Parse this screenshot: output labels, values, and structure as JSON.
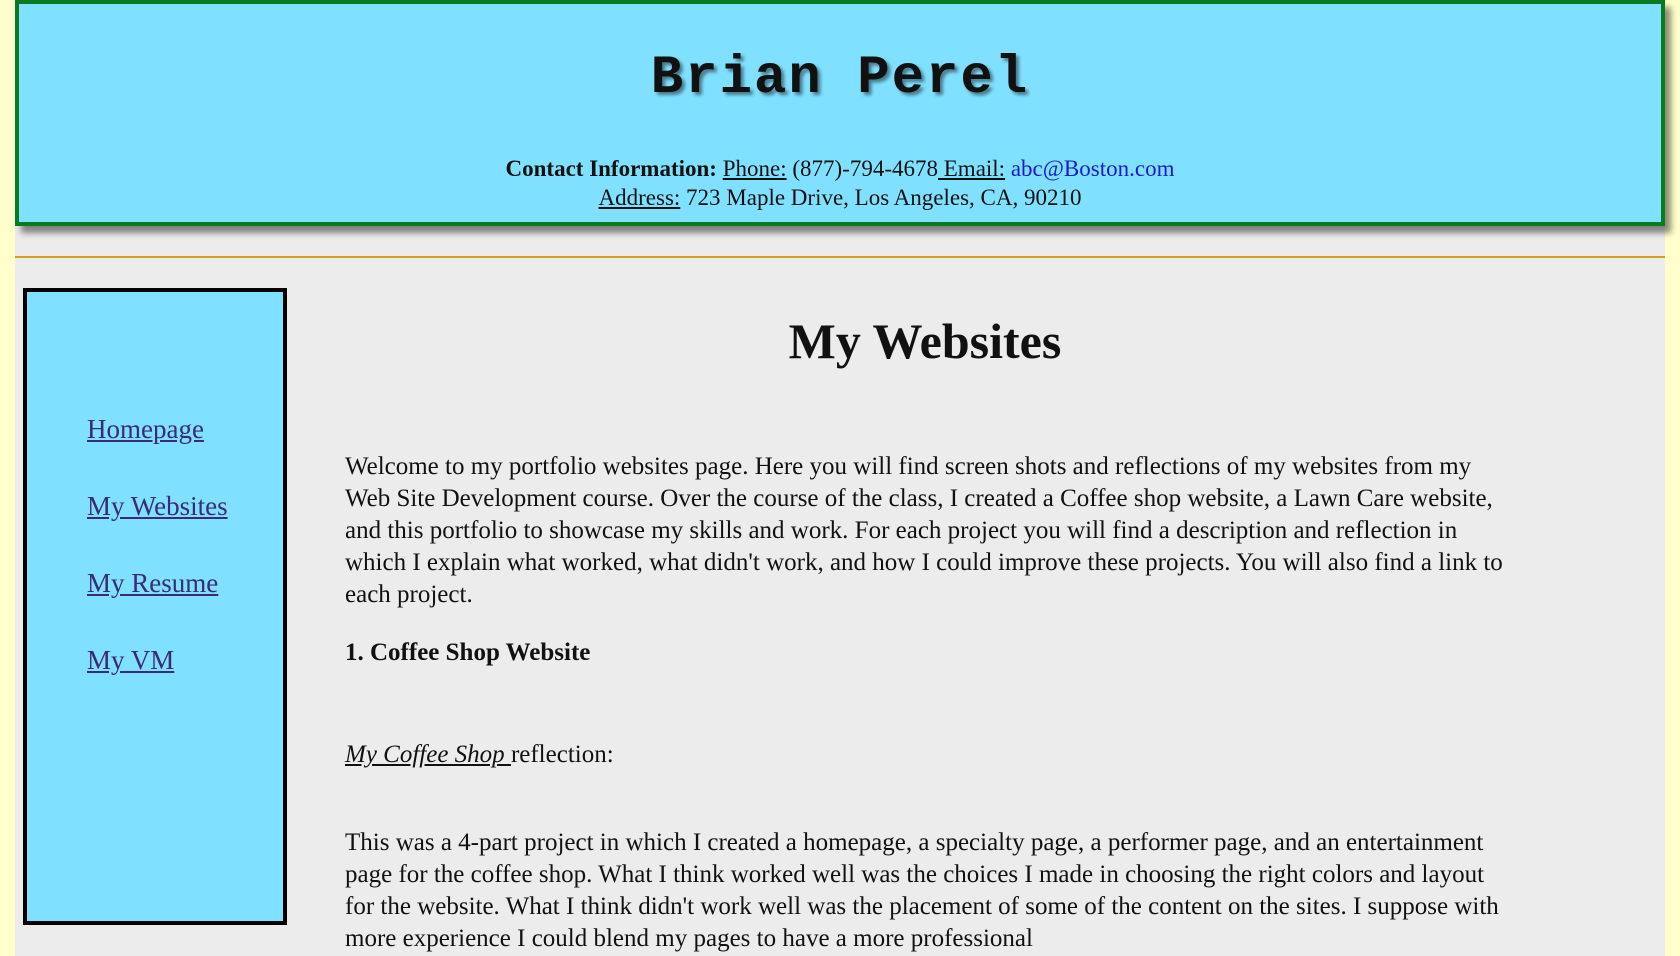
{
  "header": {
    "name": "Brian Perel",
    "contact_label": "Contact Information:",
    "phone_label": "Phone:",
    "phone_value": " (877)-794-4678",
    "email_label": " Email:",
    "email_value": "abc@Boston.com",
    "address_label": " Address:",
    "address_value": " 723 Maple Drive, Los Angeles, CA, 90210"
  },
  "sidebar": {
    "items": [
      {
        "label": "Homepage"
      },
      {
        "label": "My Websites"
      },
      {
        "label": "My Resume"
      },
      {
        "label": "My VM"
      }
    ]
  },
  "main": {
    "title": "My Websites",
    "intro": "Welcome to my portfolio websites page. Here you will find screen shots and reflections of my websites from my Web Site Development course. Over the course of the class, I created a Coffee shop website, a Lawn Care website, and this portfolio to showcase my skills and work. For each project you will find a description and reflection in which I explain what worked, what didn't work, and how I could improve these projects. You will also find a link to each project.",
    "project_title": "1. Coffee Shop Website",
    "reflection_link": "My Coffee Shop ",
    "reflection_suffix": "reflection:",
    "project_text": "This was a 4-part project in which I created a homepage, a specialty page, a performer page, and an entertainment page for the coffee shop. What I think worked well was the choices I made in choosing the right colors and layout for the website. What I think didn't work well was the placement of some of the content on the sites. I suppose with more experience I could blend my pages to have a more professional"
  }
}
